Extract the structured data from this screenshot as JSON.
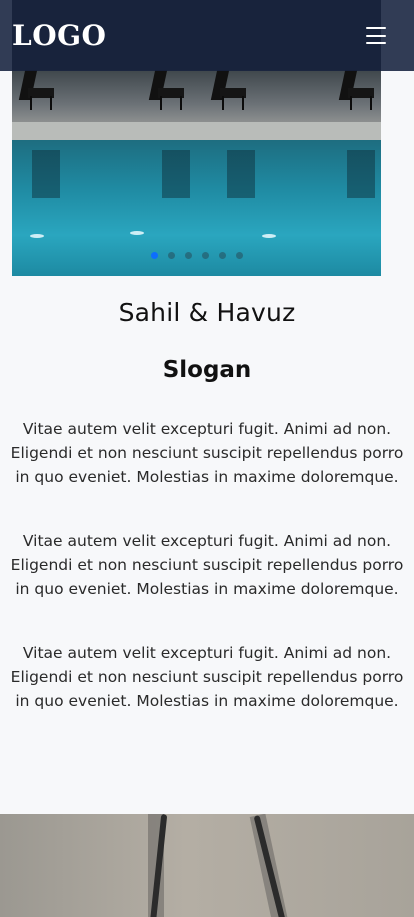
{
  "header": {
    "logo_text": "LOGO",
    "menu_icon": "hamburger-menu-icon"
  },
  "carousel": {
    "slide_count": 6,
    "active_index": 0,
    "active_color": "#0d6efd"
  },
  "section": {
    "title": "Sahil & Havuz",
    "slogan": "Slogan",
    "paragraphs": [
      "Vitae autem velit excepturi fugit. Animi ad non. Eligendi et non nesciunt suscipit repellendus porro in quo eveniet. Molestias in maxime doloremque.",
      "Vitae autem velit excepturi fugit. Animi ad non. Eligendi et non nesciunt suscipit repellendus porro in quo eveniet. Molestias in maxime doloremque.",
      "Vitae autem velit excepturi fugit. Animi ad non. Eligendi et non nesciunt suscipit repellendus porro in quo eveniet. Molestias in maxime doloremque."
    ]
  },
  "colors": {
    "header_bg": "#16213e",
    "page_bg": "#f7f8fa"
  }
}
